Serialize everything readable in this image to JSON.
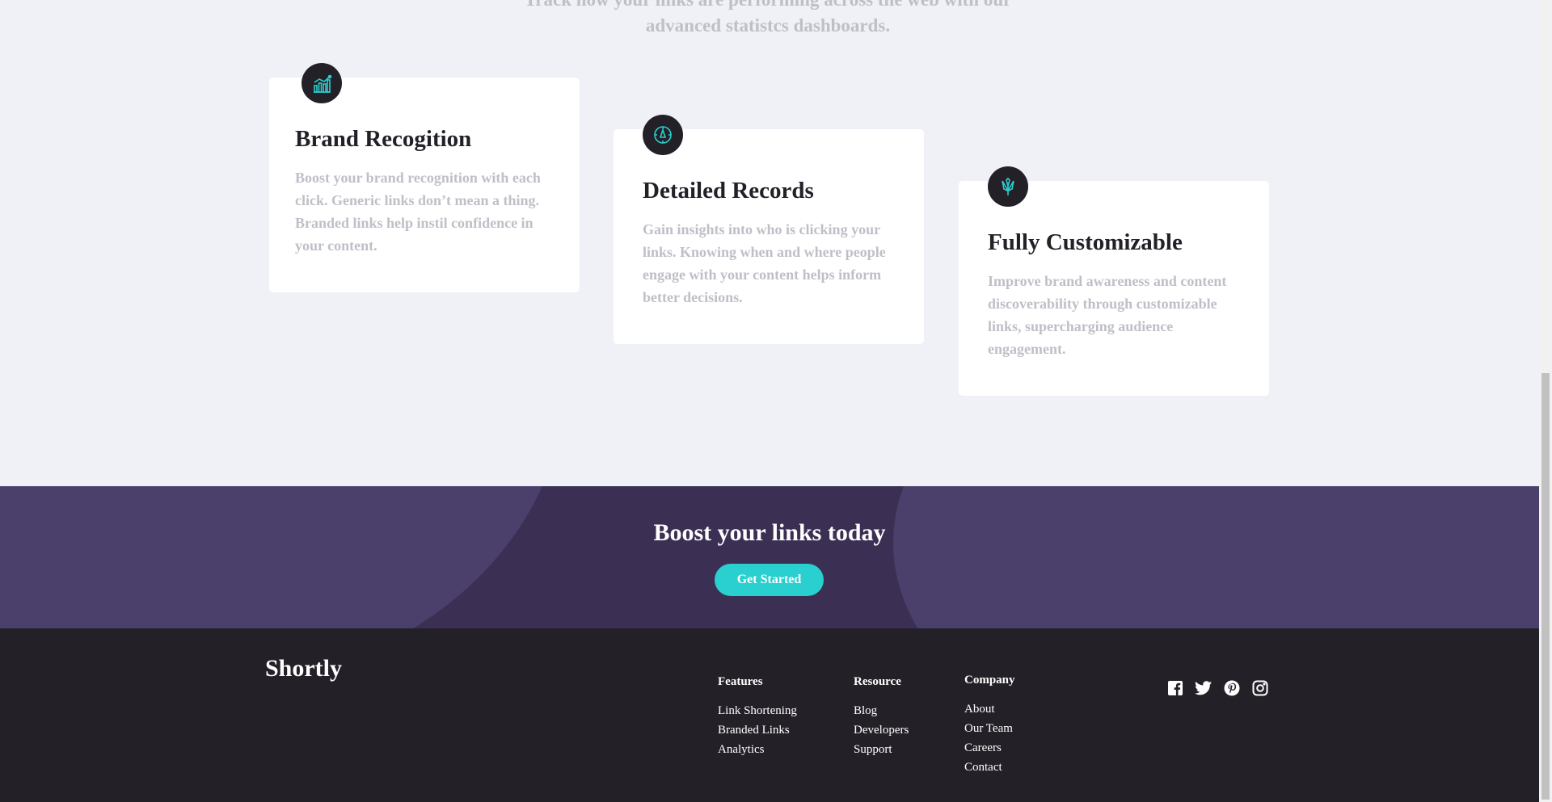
{
  "stats": {
    "intro": "Track how your links are performing across the web with our advanced statistcs dashboards.",
    "cards": [
      {
        "title": "Brand Recogition",
        "body": "Boost your brand recognition with each click. Generic links don’t mean a thing. Branded links help instil confidence in your content.",
        "icon": "brand-recognition-icon"
      },
      {
        "title": "Detailed Records",
        "body": "Gain insights into who is clicking your links. Knowing when and where people engage with your content helps inform better decisions.",
        "icon": "detailed-records-icon"
      },
      {
        "title": "Fully Customizable",
        "body": "Improve brand awareness and content discoverability through customizable links, supercharging audience engagement.",
        "icon": "fully-customizable-icon"
      }
    ]
  },
  "boost": {
    "title": "Boost your links today",
    "cta_label": "Get Started"
  },
  "footer": {
    "logo": "Shortly",
    "columns": [
      {
        "heading": "Features",
        "links": [
          "Link Shortening",
          "Branded Links",
          "Analytics"
        ]
      },
      {
        "heading": "Resource",
        "links": [
          "Blog",
          "Developers",
          "Support"
        ]
      },
      {
        "heading": "Company",
        "links": [
          "About",
          "Our Team",
          "Careers",
          "Contact"
        ]
      }
    ],
    "socials": [
      "facebook-icon",
      "twitter-icon",
      "pinterest-icon",
      "instagram-icon"
    ]
  },
  "colors": {
    "cyan": "#2acfcf",
    "dark_violet": "#3b3054",
    "very_dark_violet": "#232127",
    "gray": "#bfbfc8",
    "background": "#eff1f6"
  }
}
